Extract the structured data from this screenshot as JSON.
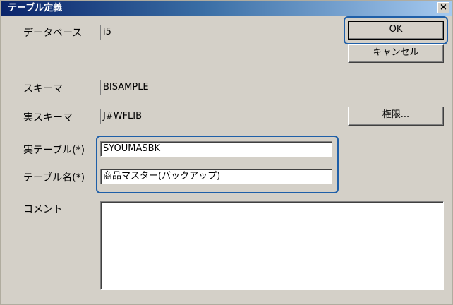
{
  "window": {
    "title": "テーブル定義",
    "close_glyph": "×"
  },
  "fields": {
    "database": {
      "label": "データベース",
      "value": "i5"
    },
    "schema": {
      "label": "スキーマ",
      "value": "BISAMPLE"
    },
    "real_schema": {
      "label": "実スキーマ",
      "value": "J#WFLIB"
    },
    "real_table": {
      "label": "実テーブル(*)",
      "value": "SYOUMASBK"
    },
    "table_name": {
      "label": "テーブル名(*)",
      "value": "商品マスター(バックアップ)"
    },
    "comment": {
      "label": "コメント",
      "value": ""
    }
  },
  "buttons": {
    "ok": "OK",
    "cancel": "キャンセル",
    "permissions": "権限..."
  },
  "icons": {
    "scroll_up": "▲",
    "scroll_down": "▼",
    "scroll_left": "◀",
    "scroll_right": "▶"
  },
  "colors": {
    "highlight": "#1f5fa8",
    "titlebar_start": "#0a246a",
    "dialog_bg": "#d4d0c8"
  }
}
